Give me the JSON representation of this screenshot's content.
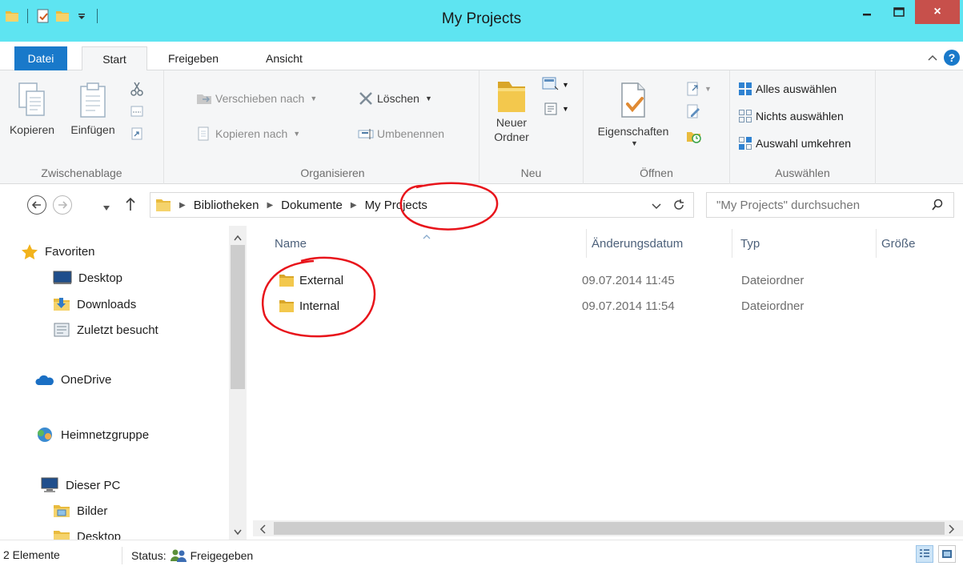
{
  "window": {
    "title": "My Projects",
    "close_glyph": "×"
  },
  "ribbon_tabs": {
    "datei": "Datei",
    "start": "Start",
    "freigeben": "Freigeben",
    "ansicht": "Ansicht",
    "help": "?"
  },
  "groups": {
    "zwischenablage": {
      "label": "Zwischenablage",
      "kopieren": "Kopieren",
      "einfuegen": "Einfügen"
    },
    "organisieren": {
      "label": "Organisieren",
      "verschieben": "Verschieben nach",
      "kopieren_nach": "Kopieren nach",
      "loeschen": "Löschen",
      "umbenennen": "Umbenennen"
    },
    "neu": {
      "label": "Neu",
      "neuer_ordner_line1": "Neuer",
      "neuer_ordner_line2": "Ordner"
    },
    "oeffnen": {
      "label": "Öffnen",
      "eigenschaften": "Eigenschaften"
    },
    "auswaehlen": {
      "label": "Auswählen",
      "alles": "Alles auswählen",
      "nichts": "Nichts auswählen",
      "umkehren": "Auswahl umkehren"
    }
  },
  "address": {
    "crumbs": [
      "Bibliotheken",
      "Dokumente",
      "My Projects"
    ],
    "search_placeholder": "\"My Projects\" durchsuchen"
  },
  "nav": {
    "favoriten": "Favoriten",
    "desktop": "Desktop",
    "downloads": "Downloads",
    "zuletzt": "Zuletzt besucht",
    "onedrive": "OneDrive",
    "heimnetz": "Heimnetzgruppe",
    "dieser_pc": "Dieser PC",
    "bilder": "Bilder",
    "desktop2": "Desktop"
  },
  "columns": {
    "name": "Name",
    "datum": "Änderungsdatum",
    "typ": "Typ",
    "groesse": "Größe"
  },
  "files": [
    {
      "name": "External",
      "date": "09.07.2014 11:45",
      "type": "Dateiordner"
    },
    {
      "name": "Internal",
      "date": "09.07.2014 11:54",
      "type": "Dateiordner"
    }
  ],
  "status": {
    "count": "2 Elemente",
    "status_label": "Status:",
    "status_value": "Freigegeben"
  },
  "colors": {
    "titlebar": "#5ee4f1",
    "accent": "#1979ca",
    "close": "#c7504b",
    "annotation": "#e8141b"
  }
}
